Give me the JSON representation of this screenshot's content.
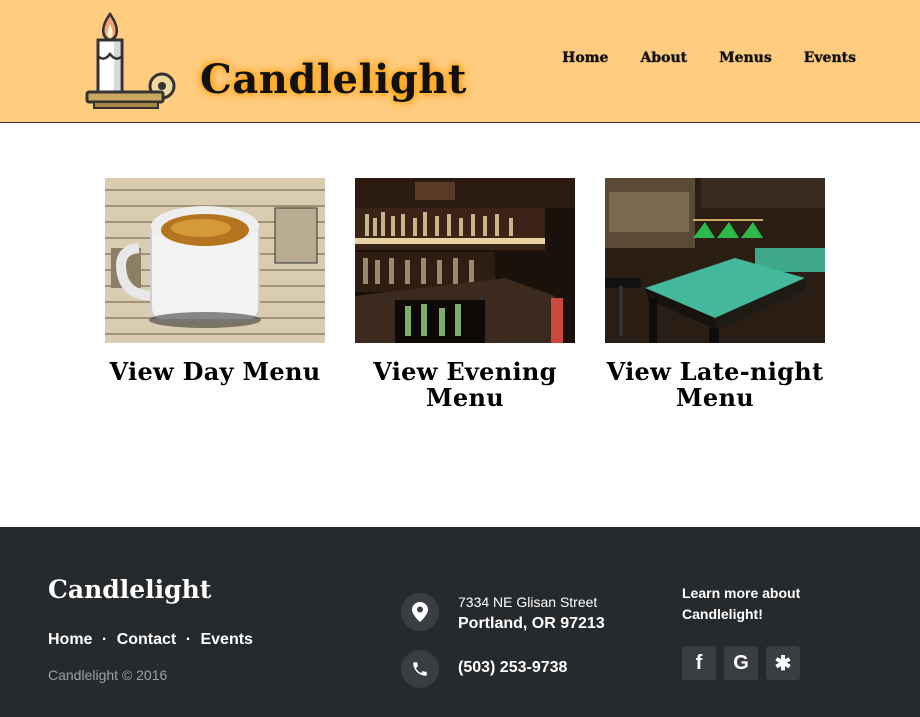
{
  "header": {
    "brand": "Candlelight",
    "nav": [
      "Home",
      "About",
      "Menus",
      "Events"
    ]
  },
  "cards": [
    {
      "title": "View Day Menu",
      "image": "coffee-mug-photo"
    },
    {
      "title": "View Evening Menu",
      "image": "bar-shelves-photo"
    },
    {
      "title": "View Late-night Menu",
      "image": "pool-table-photo"
    }
  ],
  "footer": {
    "brand": "Candlelight",
    "links": [
      "Home",
      "Contact",
      "Events"
    ],
    "separator": "·",
    "copyright": "Candlelight © 2016",
    "address_line1": "7334 NE Glisan Street",
    "address_line2": "Portland, OR 97213",
    "phone": "(503) 253-9738",
    "learn_more": "Learn more about Candlelight!",
    "social": [
      "facebook-icon",
      "google-icon",
      "yelp-icon"
    ],
    "social_glyphs": [
      "f",
      "G",
      "✱"
    ]
  },
  "colors": {
    "header_bg": "#ffcc80",
    "brand_glow": "#ff9800",
    "footer_bg": "#272a2d",
    "icon_bg": "#3a3d41"
  }
}
